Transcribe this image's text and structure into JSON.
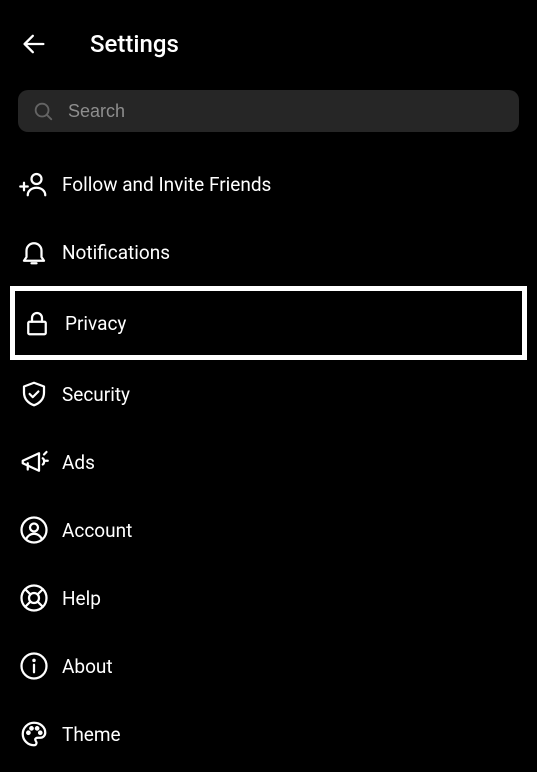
{
  "header": {
    "title": "Settings"
  },
  "search": {
    "placeholder": "Search"
  },
  "menu": {
    "items": [
      {
        "label": "Follow and Invite Friends"
      },
      {
        "label": "Notifications"
      },
      {
        "label": "Privacy"
      },
      {
        "label": "Security"
      },
      {
        "label": "Ads"
      },
      {
        "label": "Account"
      },
      {
        "label": "Help"
      },
      {
        "label": "About"
      },
      {
        "label": "Theme"
      }
    ],
    "highlighted_index": 2
  }
}
